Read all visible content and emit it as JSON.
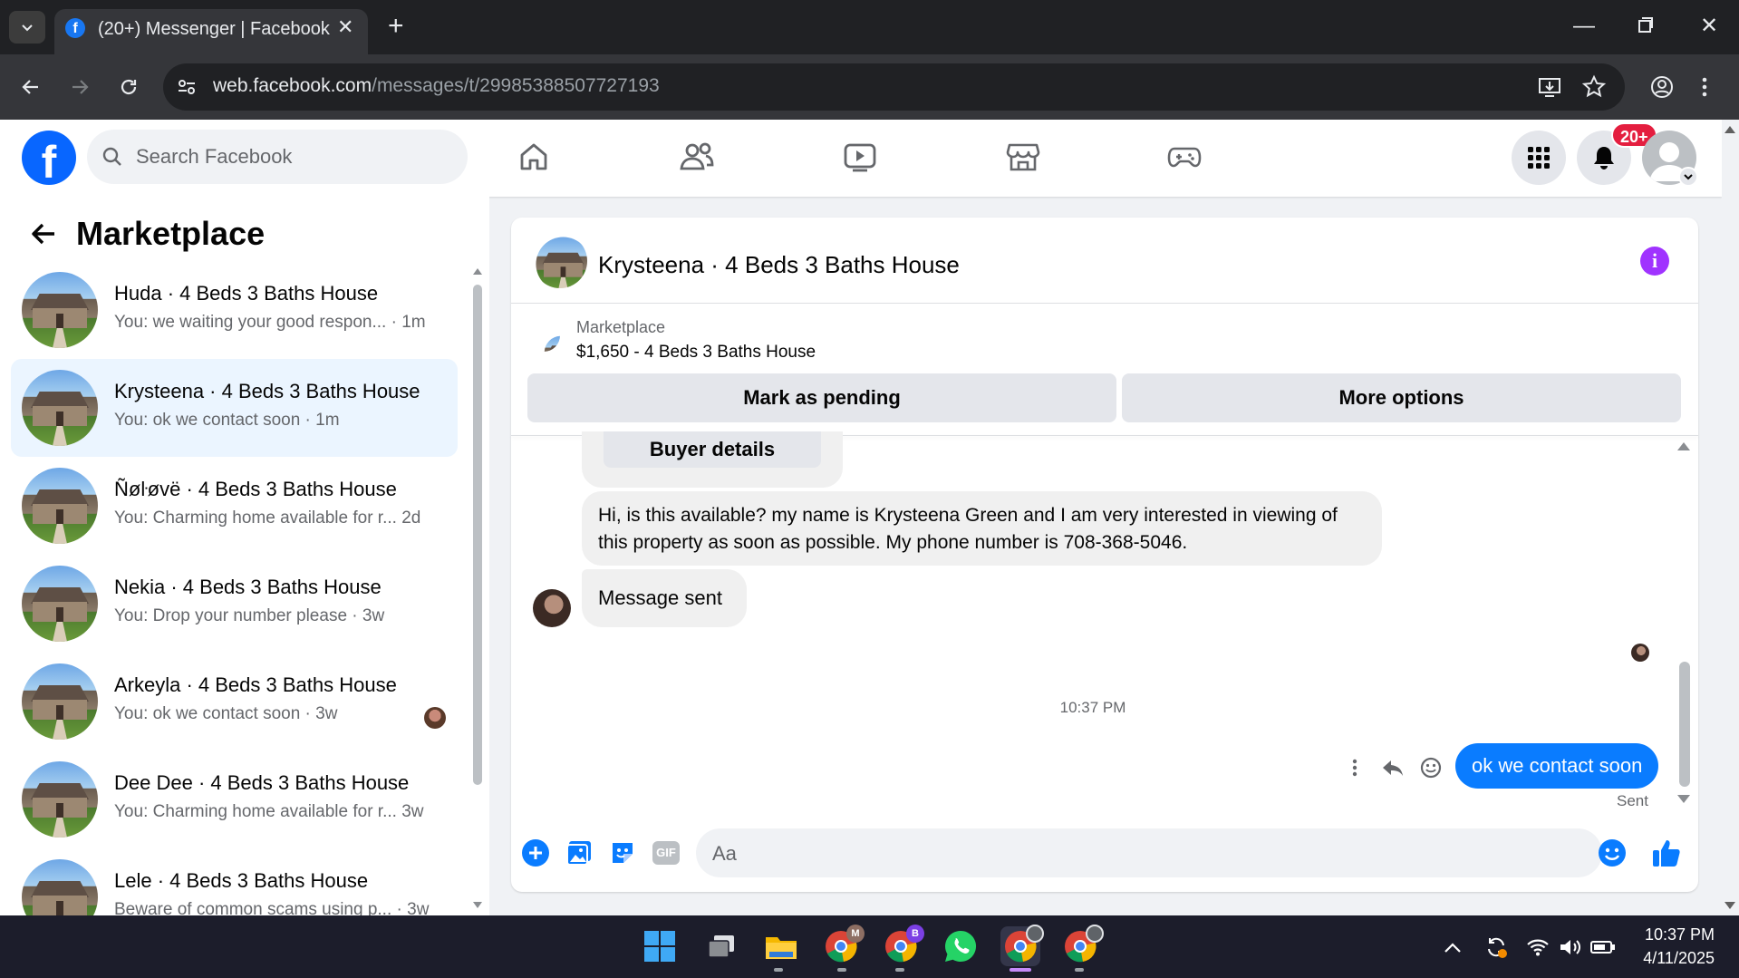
{
  "browser": {
    "tab_title": "(20+) Messenger | Facebook",
    "url_host": "web.facebook.com",
    "url_path": "/messages/t/29985388507727193"
  },
  "fb_header": {
    "search_placeholder": "Search Facebook",
    "notification_badge": "20+",
    "logo_letter": "f"
  },
  "sidebar": {
    "title": "Marketplace",
    "conversations": [
      {
        "name": "Huda · 4 Beds 3 Baths House",
        "last": "You: we waiting your good respon... · 1m",
        "active": false
      },
      {
        "name": "Krysteena · 4 Beds 3 Baths House",
        "last": "You: ok we contact soon · 1m",
        "active": true
      },
      {
        "name": "Ñøŀøvë · 4 Beds 3 Baths House",
        "last": "You: Charming home available for r...   2d",
        "active": false
      },
      {
        "name": "Nekia · 4 Beds 3 Baths House",
        "last": "You: Drop your number please · 3w",
        "active": false
      },
      {
        "name": "Arkeyla · 4 Beds 3 Baths House",
        "last": "You: ok we contact soon · 3w",
        "active": false
      },
      {
        "name": "Dee Dee · 4 Beds 3 Baths House",
        "last": "You: Charming home available for r...   3w",
        "active": false
      },
      {
        "name": "Lele · 4 Beds 3 Baths House",
        "last": "Beware of common scams using p...  · 3w",
        "active": false
      }
    ]
  },
  "chat": {
    "title": "Krysteena · 4 Beds 3 Baths House",
    "listing_label": "Marketplace",
    "listing_title": "$1,650 - 4 Beds 3 Baths House",
    "mark_pending_label": "Mark as pending",
    "more_options_label": "More options",
    "buyer_details_label": "Buyer details",
    "messages": {
      "incoming_1": "Hi, is this available? my name is Krysteena Green and I am very interested in viewing of this property as soon as possible. My phone number is 708-368-5046.",
      "incoming_2": "Message sent",
      "timestamp": "10:37 PM",
      "outgoing": "ok we contact soon",
      "status": "Sent"
    },
    "composer_placeholder": "Aa",
    "gif_label": "GIF"
  },
  "taskbar": {
    "time": "10:37 PM",
    "date": "4/11/2025",
    "chrome_profile_badges": [
      "M",
      "B"
    ]
  },
  "colors": {
    "facebook_blue": "#0866ff",
    "messenger_blue": "#0a7cff",
    "notification_red": "#e41e3f",
    "info_purple": "#a033ff"
  }
}
